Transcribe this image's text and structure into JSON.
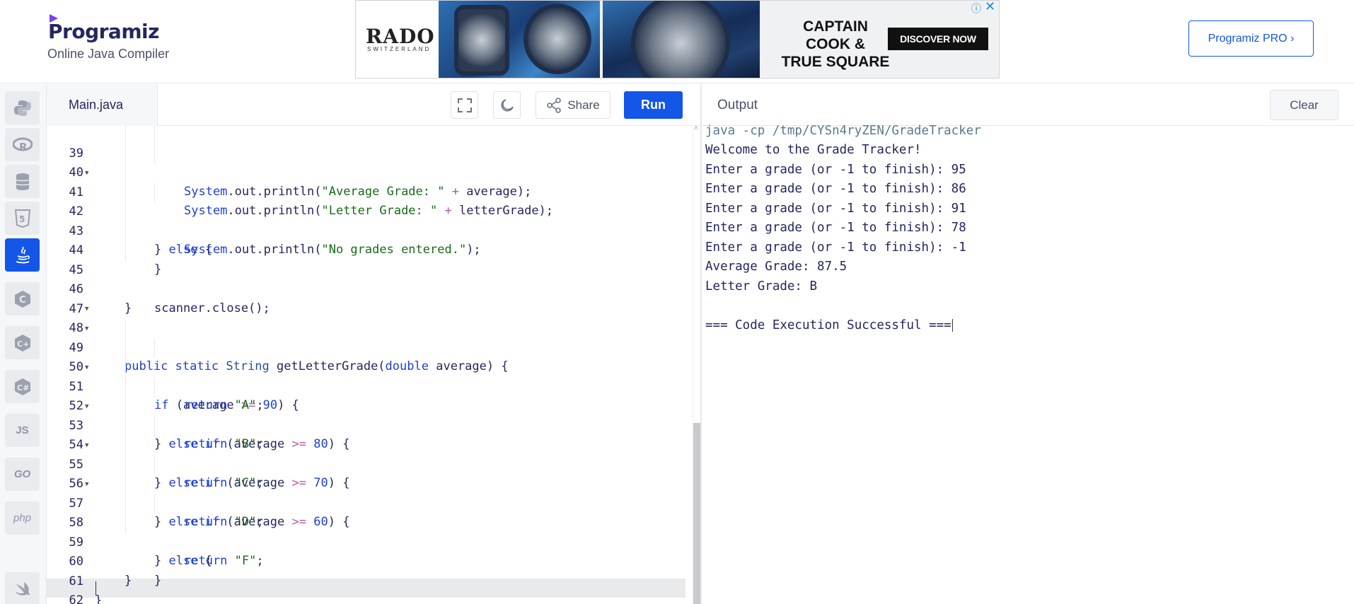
{
  "header": {
    "logo_text": "Programiz",
    "subtitle": "Online Java Compiler",
    "pro_button": "Programiz PRO ›"
  },
  "ad": {
    "brand": "RADO",
    "brand_sub": "SWITZERLAND",
    "headline_line1": "CAPTAIN COOK &",
    "headline_line2": "TRUE SQUARE",
    "cta": "DISCOVER NOW",
    "info_icon": "info-icon",
    "close_icon": "close-icon"
  },
  "sidebar": {
    "items": [
      {
        "name": "python",
        "icon": "python-icon",
        "label": "",
        "active": false
      },
      {
        "name": "r",
        "icon": "r-icon",
        "label": "",
        "active": false
      },
      {
        "name": "sql",
        "icon": "database-icon",
        "label": "",
        "active": false
      },
      {
        "name": "html",
        "icon": "html5-icon",
        "label": "",
        "active": false
      },
      {
        "name": "java",
        "icon": "java-icon",
        "label": "",
        "active": true
      },
      {
        "name": "c",
        "icon": "c-icon",
        "label": "",
        "active": false
      },
      {
        "name": "cpp",
        "icon": "cpp-icon",
        "label": "",
        "active": false
      },
      {
        "name": "csharp",
        "icon": "csharp-icon",
        "label": "",
        "active": false
      },
      {
        "name": "js",
        "icon": "js-icon",
        "label": "JS",
        "active": false
      },
      {
        "name": "go",
        "icon": "go-icon",
        "label": "GO",
        "active": false
      },
      {
        "name": "php",
        "icon": "php-icon",
        "label": "php",
        "active": false
      },
      {
        "name": "swift",
        "icon": "swift-icon",
        "label": "",
        "active": false
      }
    ]
  },
  "editor": {
    "file_tab": "Main.java",
    "share_label": "Share",
    "run_label": "Run",
    "lines": [
      {
        "n": "39",
        "fold": false
      },
      {
        "n": "40",
        "fold": false
      },
      {
        "n": "41",
        "fold": true
      },
      {
        "n": "42",
        "fold": false
      },
      {
        "n": "43",
        "fold": false
      },
      {
        "n": "44",
        "fold": false
      },
      {
        "n": "45",
        "fold": false
      },
      {
        "n": "46",
        "fold": false
      },
      {
        "n": "47",
        "fold": false
      },
      {
        "n": "48",
        "fold": true
      },
      {
        "n": "49",
        "fold": true
      },
      {
        "n": "50",
        "fold": false
      },
      {
        "n": "51",
        "fold": true
      },
      {
        "n": "52",
        "fold": false
      },
      {
        "n": "53",
        "fold": true
      },
      {
        "n": "54",
        "fold": false
      },
      {
        "n": "55",
        "fold": true
      },
      {
        "n": "56",
        "fold": false
      },
      {
        "n": "57",
        "fold": true
      },
      {
        "n": "58",
        "fold": false
      },
      {
        "n": "59",
        "fold": false
      },
      {
        "n": "60",
        "fold": false
      },
      {
        "n": "61",
        "fold": false
      },
      {
        "n": "62",
        "fold": false
      }
    ],
    "code": {
      "l39_a": "System",
      "l39_b": ".out.println(",
      "l39_c": "\"Average Grade: \"",
      "l39_d": " + ",
      "l39_e": "average);",
      "l40_a": "System",
      "l40_b": ".out.println(",
      "l40_c": "\"Letter Grade: \"",
      "l40_d": " + ",
      "l40_e": "letterGrade);",
      "l41_a": "} ",
      "l41_b": "else",
      "l41_c": " {",
      "l42_a": "System",
      "l42_b": ".out.println(",
      "l42_c": "\"No grades entered.\"",
      "l42_d": ");",
      "l43": "}",
      "l45": "scanner.close();",
      "l46": "}",
      "l48_a": "public",
      "l48_b": "static",
      "l48_c": "String",
      "l48_d": "getLetterGrade(",
      "l48_e": "double",
      "l48_f": "average) {",
      "l49_a": "if",
      "l49_b": "(average ",
      "l49_c": ">=",
      "l49_d": "90",
      "l49_e": ") {",
      "l50_a": "return",
      "l50_b": "\"A\"",
      "l50_c": ";",
      "l51_a": "} ",
      "l51_b": "else if",
      "l51_c": " (average ",
      "l51_d": ">=",
      "l51_e": "80",
      "l51_f": ") {",
      "l52_a": "return",
      "l52_b": "\"B\"",
      "l52_c": ";",
      "l53_a": "} ",
      "l53_b": "else if",
      "l53_c": " (average ",
      "l53_d": ">=",
      "l53_e": "70",
      "l53_f": ") {",
      "l54_a": "return",
      "l54_b": "\"C\"",
      "l54_c": ";",
      "l55_a": "} ",
      "l55_b": "else if",
      "l55_c": " (average ",
      "l55_d": ">=",
      "l55_e": "60",
      "l55_f": ") {",
      "l56_a": "return",
      "l56_b": "\"D\"",
      "l56_c": ";",
      "l57_a": "} ",
      "l57_b": "else",
      "l57_c": " {",
      "l58_a": "return",
      "l58_b": "\"F\"",
      "l58_c": ";",
      "l59": "}",
      "l60": "}",
      "l61": "}"
    }
  },
  "output": {
    "title": "Output",
    "clear_label": "Clear",
    "lines": [
      "java -cp /tmp/CYSn4ryZEN/GradeTracker",
      "Welcome to the Grade Tracker!",
      "Enter a grade (or -1 to finish): 95",
      "Enter a grade (or -1 to finish): 86",
      "Enter a grade (or -1 to finish): 91",
      "Enter a grade (or -1 to finish): 78",
      "Enter a grade (or -1 to finish): -1",
      "Average Grade: 87.5",
      "Letter Grade: B",
      "",
      "=== Code Execution Successful ==="
    ]
  },
  "colors": {
    "accent": "#1356e8",
    "text": "#25265e",
    "keyword": "#1e3fd6",
    "string": "#1a6a18"
  }
}
